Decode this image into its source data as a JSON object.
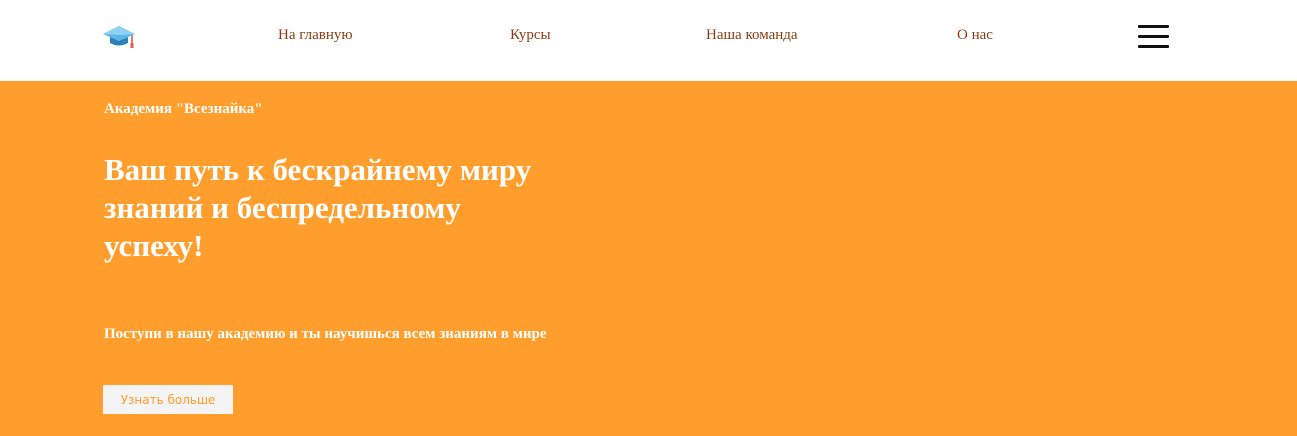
{
  "header": {
    "logo_icon": "graduation-cap-icon",
    "nav": {
      "home": "На главную",
      "courses": "Курсы",
      "team": "Наша команда",
      "about": "О нас"
    },
    "menu_icon": "hamburger-menu-icon"
  },
  "hero": {
    "academy_name": "Академия \"Всезнайка\"",
    "title": "Ваш путь к бескрайнему миру знаний и беспредельному успеху!",
    "subtitle": "Поступи в нашу академию и ты научишься всем знаниям в мире",
    "button_label": "Узнать больше"
  },
  "colors": {
    "accent": "#ff9e2c",
    "nav_text": "#8b3d12",
    "header_bg": "#ffffff",
    "button_bg": "#f4f4f4"
  }
}
